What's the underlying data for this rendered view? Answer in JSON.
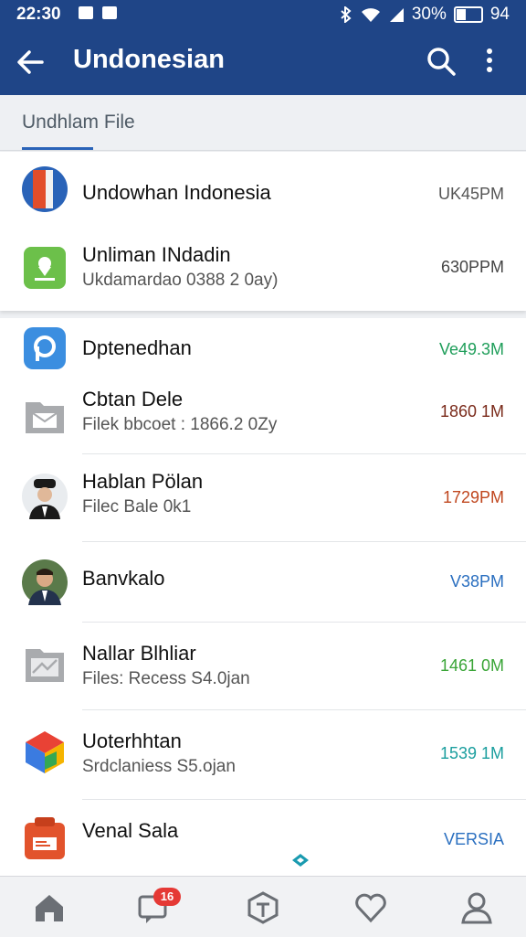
{
  "status": {
    "time": "22:30",
    "battery": "30%",
    "right": "94"
  },
  "appbar": {
    "title": "Undonesian",
    "icons": [
      "back-arrow-icon",
      "search-icon",
      "more-vert-icon"
    ]
  },
  "tab": {
    "label": "Undhlam File"
  },
  "section1": [
    {
      "name": "Undowhan  Indonesia",
      "sub": "",
      "time": "UK45PM",
      "time_color": "#555555",
      "icon": "indonesia-flag-icon"
    },
    {
      "name": "Unliman INdadin",
      "sub": "Ukdamardao 0388 2 0ay)",
      "time": "630PPM",
      "time_color": "#444444",
      "icon": "map-pin-icon"
    }
  ],
  "section2": [
    {
      "name": "Dptenedhan",
      "sub": "",
      "time": "Ve49.3M",
      "time_color": "#1f9e5a",
      "icon": "p-app-icon"
    },
    {
      "name": "Cbtan Dele",
      "sub": "Filek bbcoet : 1866.2 0Zy",
      "time": "1860 1M",
      "time_color": "#7a2a1a",
      "icon": "mail-folder-icon"
    },
    {
      "name": "Hablan Pölan",
      "sub": "Filec Bale 0k1",
      "time": "1729PM",
      "time_color": "#c0471f",
      "icon": "avatar-officer-icon"
    },
    {
      "name": "Banvkalo",
      "sub": "",
      "time": "V38PM",
      "time_color": "#2a6fc0",
      "icon": "avatar-man-icon"
    },
    {
      "name": "Nallar Blhliar",
      "sub": "Files: Recess S4.0jan",
      "time": "1461 0M",
      "time_color": "#3aa537",
      "icon": "image-folder-icon"
    },
    {
      "name": "Uoterhhtan",
      "sub": "Srdclaniess S5.ojan",
      "time": "1539 1M",
      "time_color": "#1a9e9e",
      "icon": "colorful-cube-icon"
    },
    {
      "name": "Venal Sala",
      "sub": "",
      "time": "VERSIA",
      "time_color": "#2a6fc0",
      "icon": "red-document-icon"
    }
  ],
  "bottomnav": {
    "badge": "16",
    "items": [
      "home-icon",
      "messages-icon",
      "box-icon",
      "heart-icon",
      "profile-icon"
    ]
  },
  "colors": {
    "primary": "#1f4587",
    "accent": "#2a63b8",
    "badge": "#e53935"
  }
}
